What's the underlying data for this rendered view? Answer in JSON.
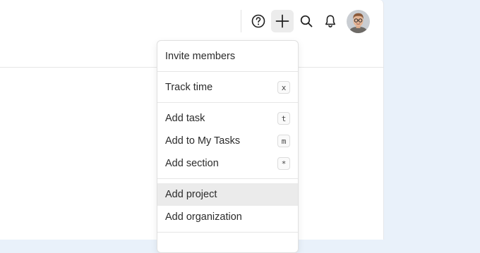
{
  "toolbar": {
    "help": {
      "icon": "help-circle-icon"
    },
    "add": {
      "icon": "plus-icon",
      "active": true
    },
    "search": {
      "icon": "search-icon"
    },
    "notifications": {
      "icon": "bell-icon"
    },
    "avatar": {
      "icon": "user-avatar"
    }
  },
  "add_menu": {
    "items": [
      {
        "label": "Invite members"
      },
      {
        "label": "Track time",
        "shortcut": "x"
      },
      {
        "label": "Add task",
        "shortcut": "t"
      },
      {
        "label": "Add to My Tasks",
        "shortcut": "m"
      },
      {
        "label": "Add section",
        "shortcut": "*"
      },
      {
        "label": "Add project",
        "highlighted": true
      },
      {
        "label": "Add organization"
      }
    ]
  },
  "colors": {
    "page_background": "#e9f1fa",
    "highlight": "#ebebeb",
    "active_button": "#ececec",
    "icon": "#1f1f1f"
  }
}
